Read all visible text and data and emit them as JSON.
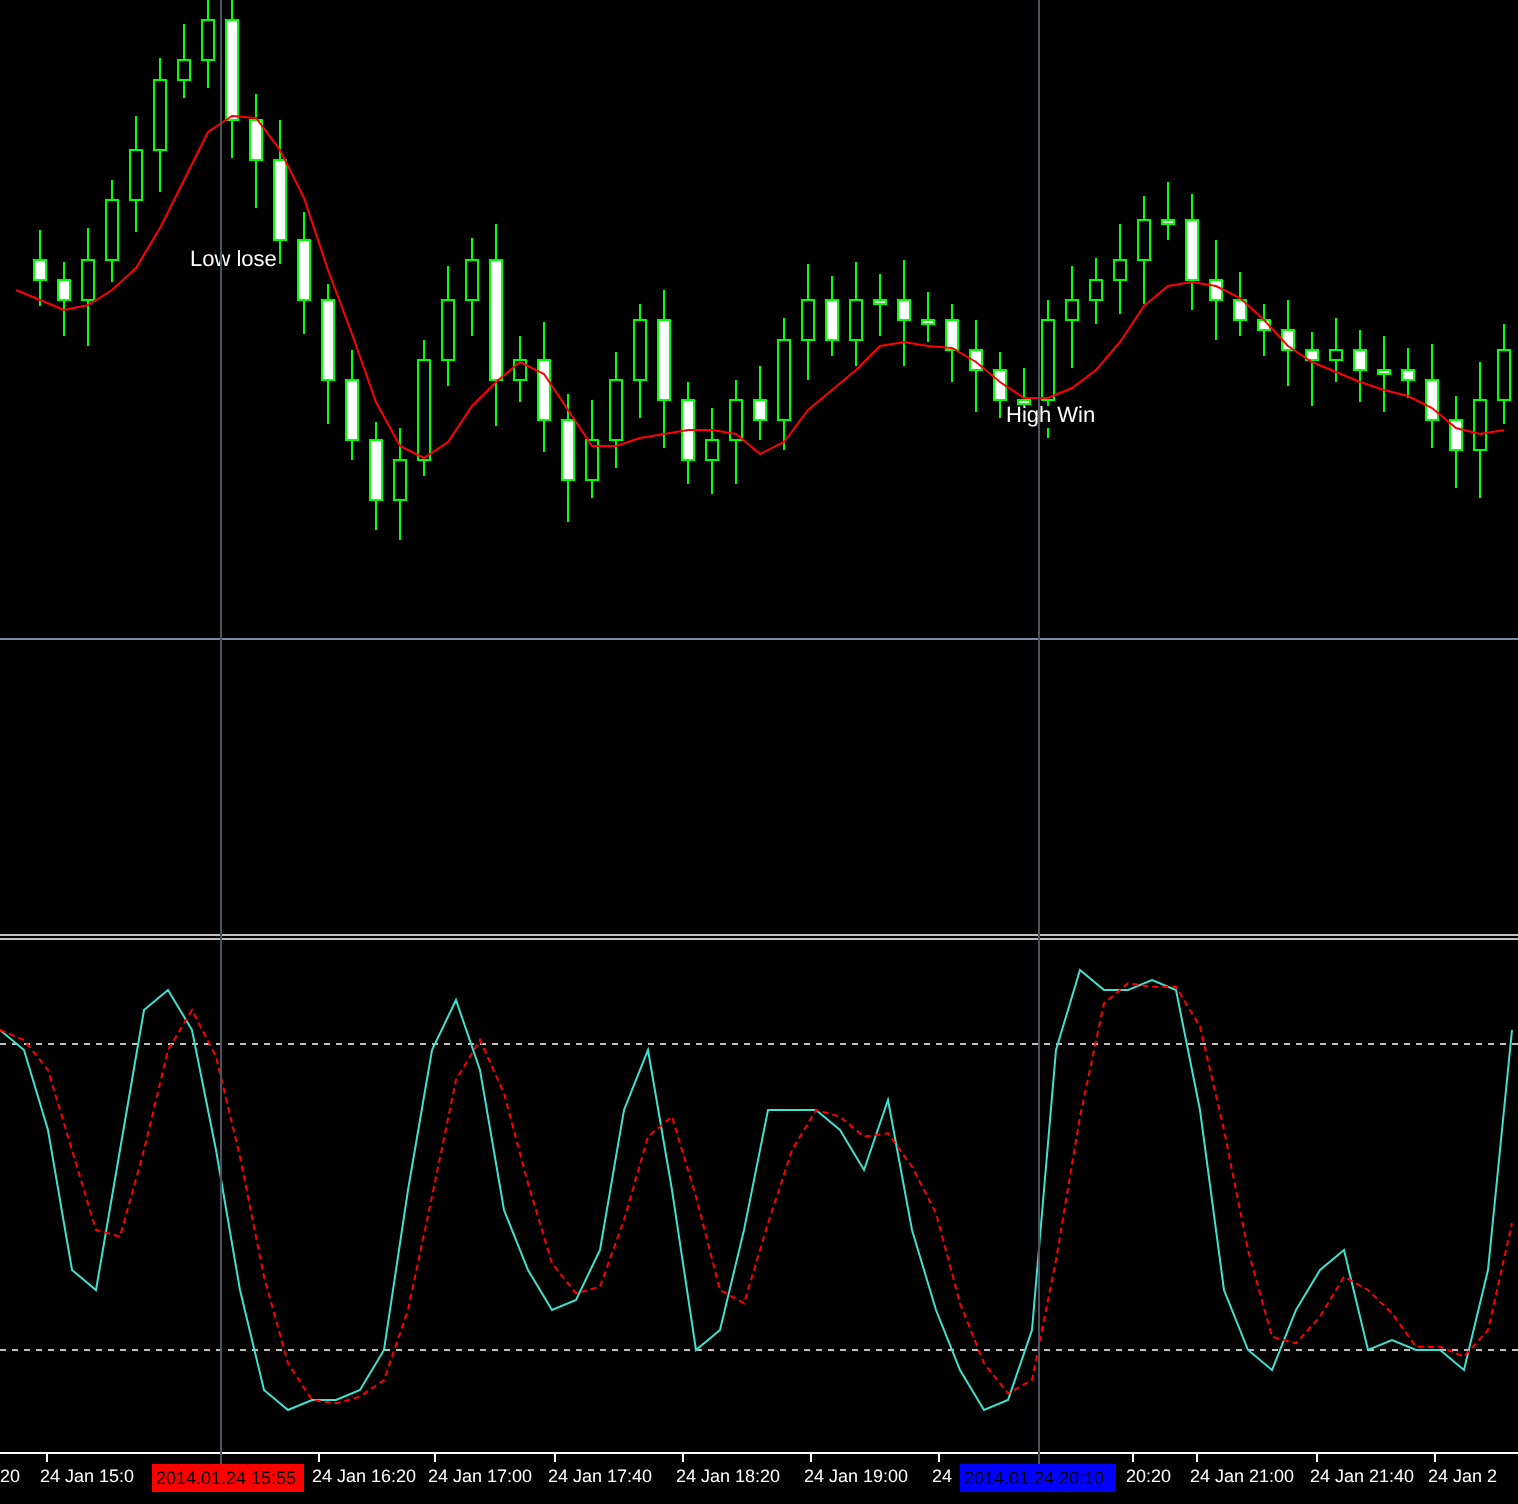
{
  "main_chart": {
    "annotations": [
      {
        "text": "Low lose"
      },
      {
        "text": "High Win"
      }
    ]
  },
  "time_axis": {
    "labels": [
      {
        "text": "20"
      },
      {
        "text": "24 Jan 15:0"
      },
      {
        "text": "24 Jan 16:20"
      },
      {
        "text": "24 Jan 17:00"
      },
      {
        "text": "24 Jan 17:40"
      },
      {
        "text": "24 Jan 18:20"
      },
      {
        "text": "24 Jan 19:00"
      },
      {
        "text": "24"
      },
      {
        "text": "20:20"
      },
      {
        "text": "24 Jan 21:00"
      },
      {
        "text": "24 Jan 21:40"
      },
      {
        "text": "24 Jan 2"
      }
    ],
    "markers": [
      {
        "text": "2014.01.24 15:55",
        "color": "#ff0000"
      },
      {
        "text": "2014.01.24 20:10",
        "color": "#0000ff"
      }
    ]
  }
}
